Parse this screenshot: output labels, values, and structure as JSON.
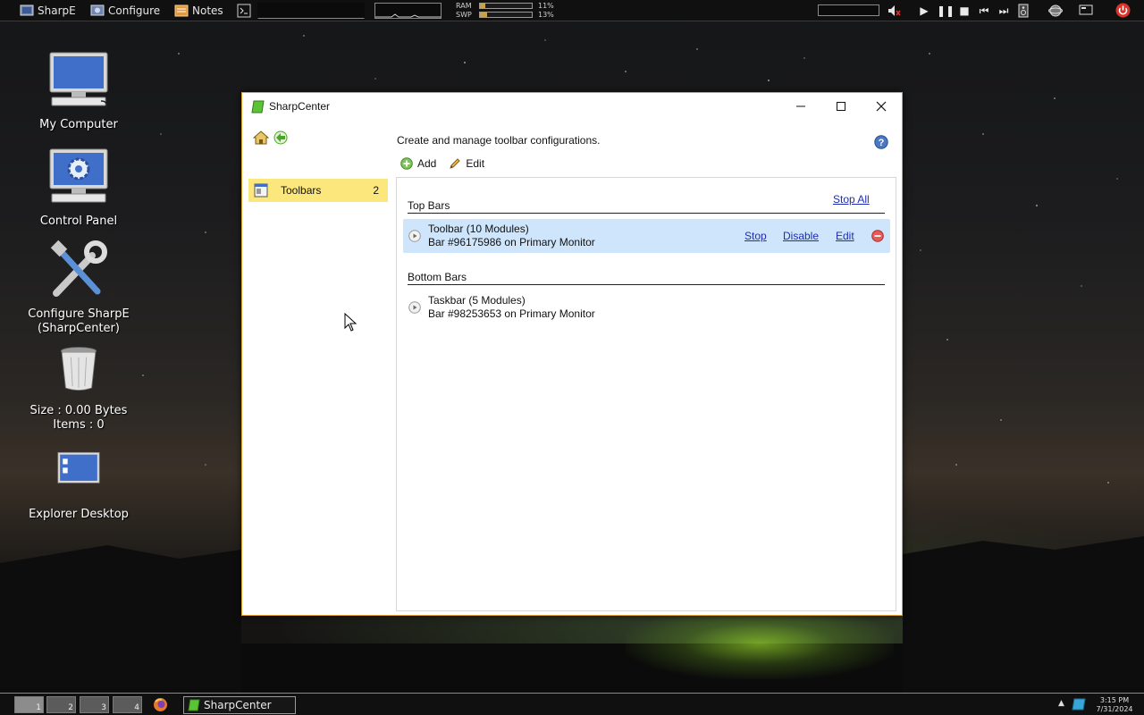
{
  "topbar": {
    "launchers": [
      {
        "label": "SharpE",
        "icon": "sharpe-icon"
      },
      {
        "label": "Configure",
        "icon": "configure-icon"
      },
      {
        "label": "Notes",
        "icon": "notes-icon"
      }
    ],
    "ram_label": "RAM",
    "swp_label": "SWP",
    "ram_percent": "11%",
    "swp_percent": "13%",
    "ram_value": 0.11,
    "swp_value": 0.13
  },
  "desktop": {
    "icons": [
      {
        "label": "My Computer",
        "icon": "computer-icon"
      },
      {
        "label": "Control Panel",
        "icon": "control-panel-icon"
      },
      {
        "label": "Configure SharpE",
        "label2": "(SharpCenter)",
        "icon": "tools-icon"
      },
      {
        "label": "Size : 0.00 Bytes",
        "label2": "Items : 0",
        "icon": "recycle-bin-icon"
      },
      {
        "label": "Explorer Desktop",
        "icon": "explorer-desktop-icon"
      }
    ]
  },
  "window": {
    "title": "SharpCenter",
    "sidebar": {
      "item_label": "Toolbars",
      "item_count": "2"
    },
    "description": "Create and manage toolbar configurations.",
    "actions": {
      "add": "Add",
      "edit": "Edit"
    },
    "top_section": {
      "title": "Top Bars",
      "stop_all": "Stop All",
      "bars": [
        {
          "name": "Toolbar (10 Modules)",
          "sub": "Bar #96175986 on Primary Monitor",
          "stop": "Stop",
          "disable": "Disable",
          "edit": "Edit"
        }
      ]
    },
    "bottom_section": {
      "title": "Bottom Bars",
      "bars": [
        {
          "name": "Taskbar (5 Modules)",
          "sub": "Bar #98253653 on Primary Monitor"
        }
      ]
    }
  },
  "taskbar": {
    "workspaces": [
      "1",
      "2",
      "3",
      "4"
    ],
    "task_label": "SharpCenter",
    "time": "3:15 PM",
    "date": "7/31/2024"
  },
  "colors": {
    "selection": "#fbe77c",
    "row_highlight": "#cfe5fb",
    "link": "#1f2eb0",
    "window_border": "#e0a030"
  }
}
